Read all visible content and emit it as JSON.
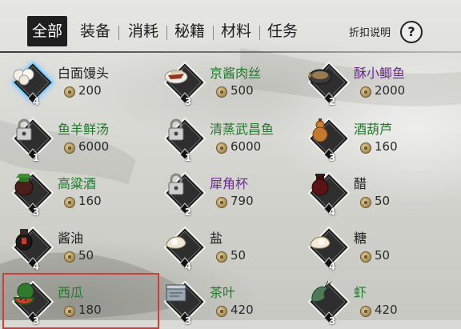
{
  "tabs": [
    {
      "label": "全部",
      "active": true
    },
    {
      "label": "装备",
      "active": false
    },
    {
      "label": "消耗",
      "active": false
    },
    {
      "label": "秘籍",
      "active": false
    },
    {
      "label": "材料",
      "active": false
    },
    {
      "label": "任务",
      "active": false
    }
  ],
  "header": {
    "explain_label": "折扣说明",
    "help_symbol": "?"
  },
  "items": [
    {
      "name": "白面馒头",
      "price": "200",
      "qty": "4",
      "color": "#1d1d1d",
      "icon": "steamed-bun-icon",
      "locked": false
    },
    {
      "name": "京酱肉丝",
      "price": "500",
      "qty": "3",
      "color": "#1e7a2a",
      "icon": "shredded-pork-icon",
      "locked": false
    },
    {
      "name": "酥小鲫鱼",
      "price": "2000",
      "qty": "2",
      "color": "#6a2a9a",
      "icon": "crucian-fish-icon",
      "locked": false
    },
    {
      "name": "鱼羊鲜汤",
      "price": "6000",
      "qty": "1",
      "color": "#1e7a2a",
      "icon": "lock-icon",
      "locked": true
    },
    {
      "name": "清蒸武昌鱼",
      "price": "6000",
      "qty": "1",
      "color": "#1e7a2a",
      "icon": "lock-icon",
      "locked": true
    },
    {
      "name": "酒葫芦",
      "price": "160",
      "qty": "3",
      "color": "#1e7a2a",
      "icon": "gourd-icon",
      "locked": false
    },
    {
      "name": "高粱酒",
      "price": "160",
      "qty": "3",
      "color": "#1e7a2a",
      "icon": "wine-jar-icon",
      "locked": false
    },
    {
      "name": "犀角杯",
      "price": "790",
      "qty": "2",
      "color": "#6a2a9a",
      "icon": "lock-icon",
      "locked": true
    },
    {
      "name": "醋",
      "price": "50",
      "qty": "4",
      "color": "#1d1d1d",
      "icon": "vinegar-jar-icon",
      "locked": false
    },
    {
      "name": "酱油",
      "price": "50",
      "qty": "4",
      "color": "#1d1d1d",
      "icon": "soy-sauce-jar-icon",
      "locked": false
    },
    {
      "name": "盐",
      "price": "50",
      "qty": "4",
      "color": "#1d1d1d",
      "icon": "salt-bag-icon",
      "locked": false
    },
    {
      "name": "糖",
      "price": "50",
      "qty": "4",
      "color": "#1d1d1d",
      "icon": "sugar-bag-icon",
      "locked": false
    },
    {
      "name": "西瓜",
      "price": "180",
      "qty": "3",
      "color": "#1e7a2a",
      "icon": "watermelon-icon",
      "locked": false
    },
    {
      "name": "茶叶",
      "price": "420",
      "qty": "3",
      "color": "#1e7a2a",
      "icon": "tea-box-icon",
      "locked": false
    },
    {
      "name": "虾",
      "price": "420",
      "qty": "3",
      "color": "#1e7a2a",
      "icon": "shrimp-icon",
      "locked": false
    }
  ]
}
